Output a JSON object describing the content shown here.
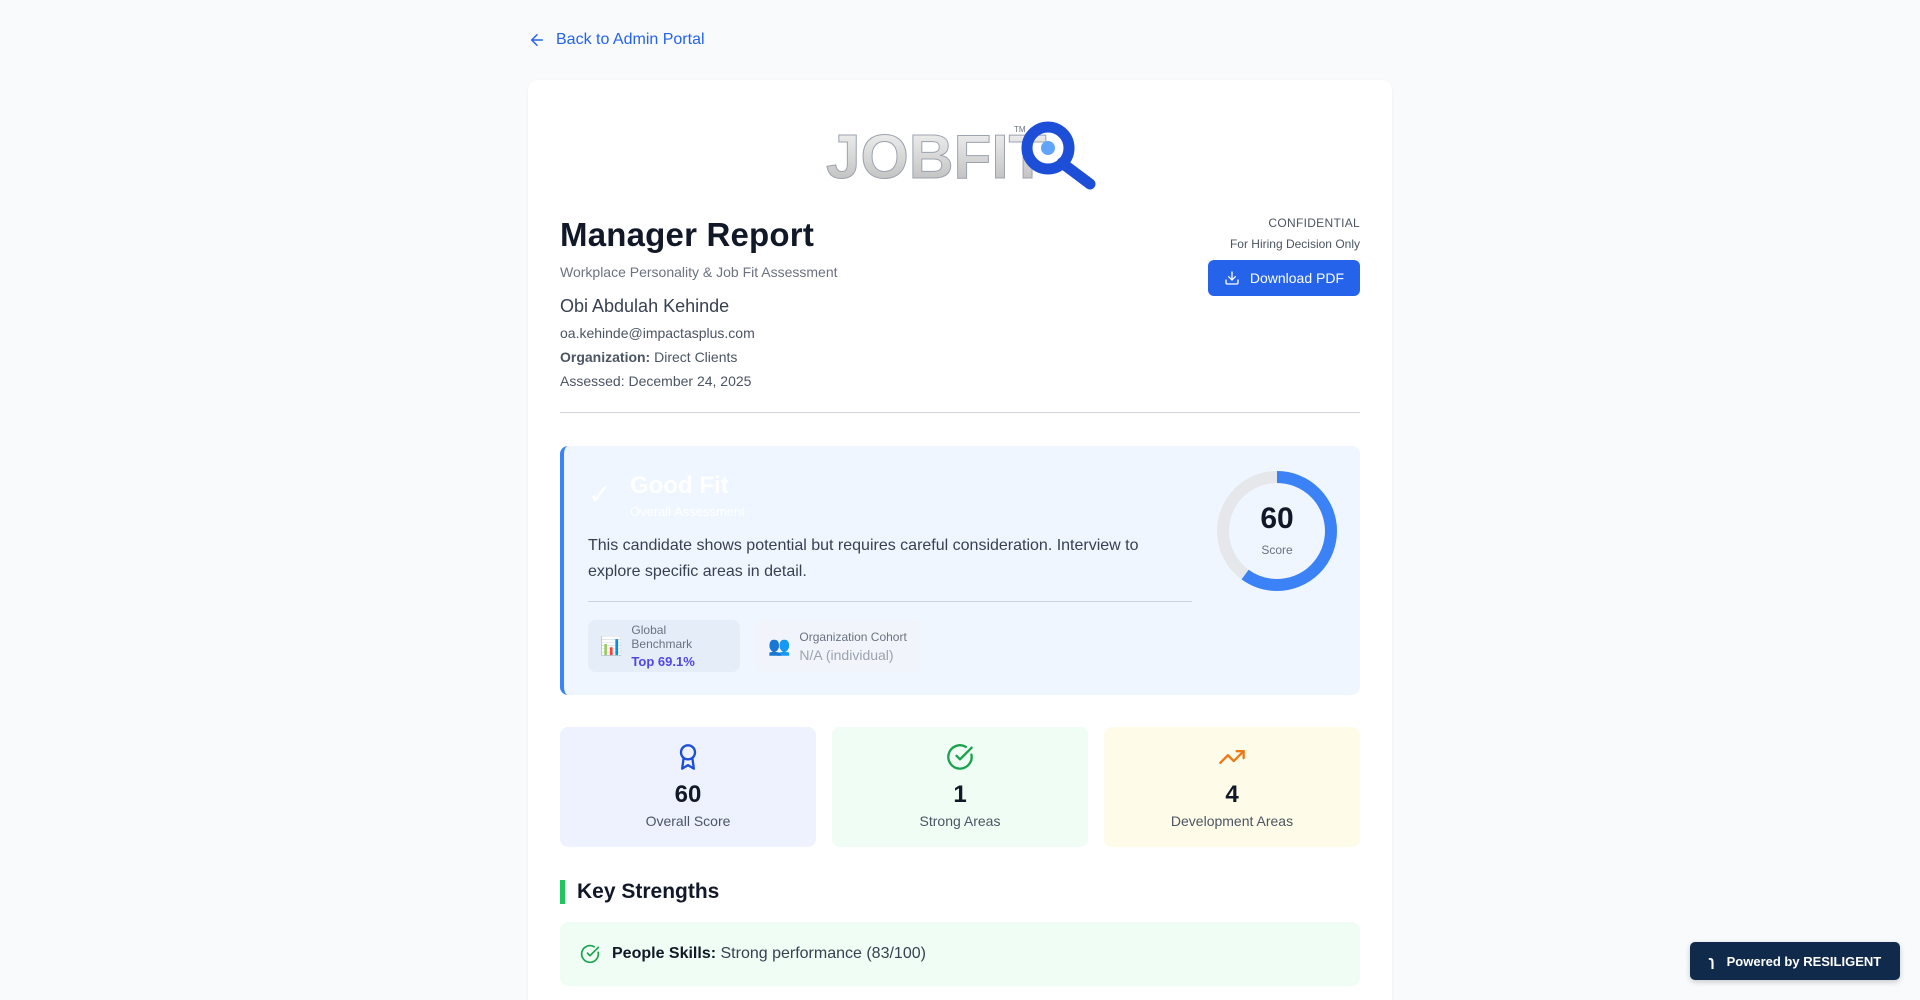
{
  "nav": {
    "back_label": "Back to Admin Portal"
  },
  "logo": {
    "text": "JOBFIT",
    "tm": "TM"
  },
  "report": {
    "title": "Manager Report",
    "subtitle": "Workplace Personality & Job Fit Assessment",
    "candidate_name": "Obi Abdulah Kehinde",
    "email": "oa.kehinde@impactasplus.com",
    "organization_label": "Organization:",
    "organization_value": "Direct Clients",
    "assessed": "Assessed: December 24, 2025",
    "confidential": "CONFIDENTIAL",
    "confidential_sub": "For Hiring Decision Only",
    "download_label": "Download PDF"
  },
  "fit": {
    "title": "Good Fit",
    "subtitle": "Overall Assessment",
    "description": "This candidate shows potential but requires careful consideration. Interview to explore specific areas in detail.",
    "score": 60,
    "score_fraction": 0.6,
    "score_label": "Score",
    "benchmarks": [
      {
        "label": "Global Benchmark",
        "value": "Top 69.1%",
        "icon": "bar-chart-icon"
      },
      {
        "label": "Organization Cohort",
        "value": "N/A (individual)",
        "icon": "people-icon"
      }
    ]
  },
  "stats": [
    {
      "value": "60",
      "label": "Overall Score",
      "icon": "award-icon"
    },
    {
      "value": "1",
      "label": "Strong Areas",
      "icon": "check-circle-icon"
    },
    {
      "value": "4",
      "label": "Development Areas",
      "icon": "trending-up-icon"
    }
  ],
  "strengths": {
    "title": "Key Strengths",
    "items": [
      {
        "name": "People Skills:",
        "text": "Strong performance (83/100)"
      }
    ]
  },
  "footer": {
    "powered_label": "Powered by RESILIGENT"
  },
  "colors": {
    "accent": "#2563eb",
    "success": "#22c55e",
    "warning": "#ea7a1a",
    "ring": "#3b82f6"
  }
}
